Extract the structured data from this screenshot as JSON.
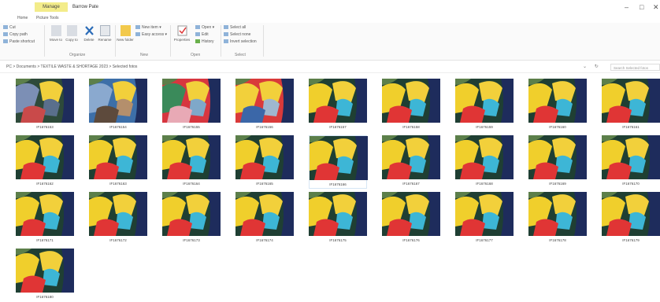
{
  "window": {
    "manage_tab": "Manage",
    "title": "Barrow Pate",
    "minimize": "–",
    "maximize": "□",
    "close": "✕"
  },
  "ribbon_tabs": [
    "Home",
    "Picture Tools"
  ],
  "ribbon": {
    "clipboard": {
      "cut": "Cut",
      "copy_path": "Copy path",
      "paste_shortcut": "Paste shortcut"
    },
    "organize": {
      "move_to": "Move to",
      "copy_to": "Copy to",
      "delete": "Delete",
      "rename": "Rename",
      "label": "Organize"
    },
    "new": {
      "new_folder": "New folder",
      "new_item": "New item",
      "easy_access": "Easy access",
      "label": "New"
    },
    "open": {
      "properties": "Properties",
      "open": "Open",
      "edit": "Edit",
      "history": "History",
      "label": "Open"
    },
    "select": {
      "select_all": "Select all",
      "select_none": "Select none",
      "invert_selection": "Invert selection",
      "label": "Select"
    }
  },
  "address": {
    "path": "PC > Documents > TEXTILE WASTE & SHORTAGE 2023 > Selected fotos",
    "search_placeholder": "Search Selected fotos"
  },
  "files": [
    {
      "name": "IF1676153"
    },
    {
      "name": "IF1676154"
    },
    {
      "name": "IF1676155"
    },
    {
      "name": "IF1676156"
    },
    {
      "name": "IF1676157"
    },
    {
      "name": "IF1676158"
    },
    {
      "name": "IF1676159"
    },
    {
      "name": "IF1676160"
    },
    {
      "name": "IF1676161"
    },
    {
      "name": "IF1676162"
    },
    {
      "name": "IF1676163"
    },
    {
      "name": "IF1676164"
    },
    {
      "name": "IF1676165"
    },
    {
      "name": "IF1676166"
    },
    {
      "name": "IF1676167"
    },
    {
      "name": "IF1676168"
    },
    {
      "name": "IF1676169"
    },
    {
      "name": "IF1676170"
    },
    {
      "name": "IF1676171"
    },
    {
      "name": "IF1676172"
    },
    {
      "name": "IF1676173"
    },
    {
      "name": "IF1676174"
    },
    {
      "name": "IF1676175"
    },
    {
      "name": "IF1676176"
    },
    {
      "name": "IF1676177"
    },
    {
      "name": "IF1676178"
    },
    {
      "name": "IF1676179"
    },
    {
      "name": "IF1676180"
    }
  ]
}
